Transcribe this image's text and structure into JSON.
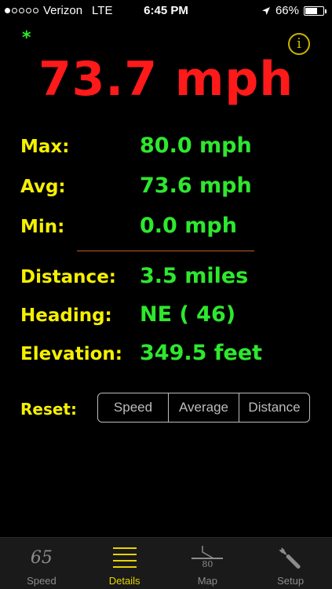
{
  "status": {
    "carrier": "Verizon",
    "network": "LTE",
    "time": "6:45 PM",
    "battery": "66%",
    "battery_level": 0.66
  },
  "indicator": "*",
  "info_symbol": "i",
  "speed_display": "73.7 mph",
  "stats": [
    {
      "label": "Max:",
      "value": "80.0 mph"
    },
    {
      "label": "Avg:",
      "value": "73.6 mph"
    },
    {
      "label": "Min:",
      "value": "0.0 mph"
    },
    {
      "label": "Distance:",
      "value": "3.5 miles"
    },
    {
      "label": "Heading:",
      "value": "NE ( 46)"
    },
    {
      "label": "Elevation:",
      "value": "349.5 feet"
    }
  ],
  "reset": {
    "label": "Reset:",
    "buttons": [
      "Speed",
      "Average",
      "Distance"
    ]
  },
  "tabs": [
    {
      "label": "Speed",
      "icon": "speedometer-65-icon",
      "icon_text": "65"
    },
    {
      "label": "Details",
      "icon": "list-lines-icon",
      "active": true
    },
    {
      "label": "Map",
      "icon": "map-road-icon",
      "icon_text": "80"
    },
    {
      "label": "Setup",
      "icon": "wrench-icon"
    }
  ],
  "colors": {
    "speed": "#ff1a1a",
    "label": "#f5f000",
    "value": "#2ee82e",
    "active_tab": "#e6d300",
    "divider": "#b8612a"
  }
}
